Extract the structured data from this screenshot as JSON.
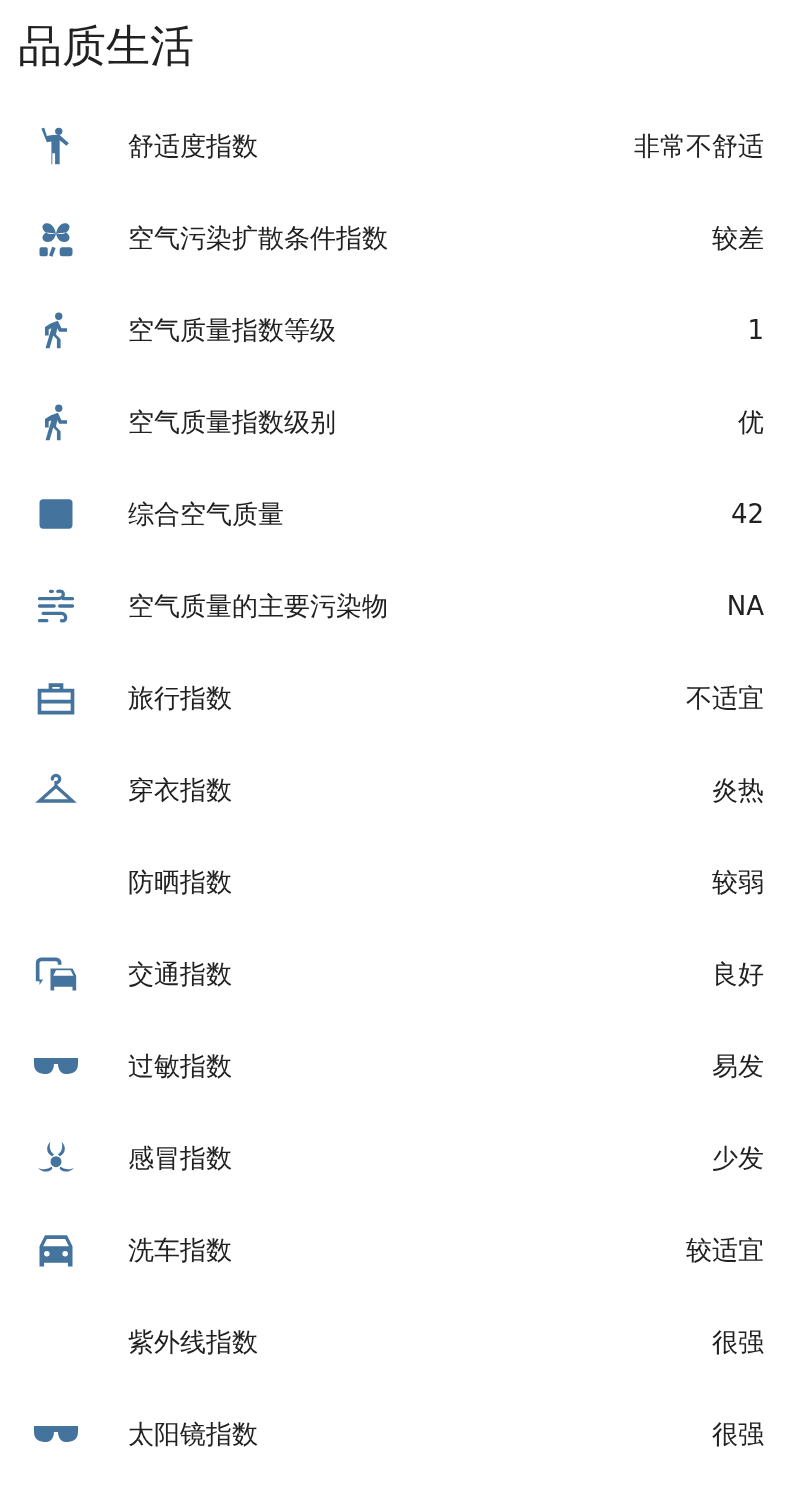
{
  "title": "品质生活",
  "rows": [
    {
      "label": "舒适度指数",
      "value": "非常不舒适"
    },
    {
      "label": "空气污染扩散条件指数",
      "value": "较差"
    },
    {
      "label": "空气质量指数等级",
      "value": "1"
    },
    {
      "label": "空气质量指数级别",
      "value": "优"
    },
    {
      "label": "综合空气质量",
      "value": "42"
    },
    {
      "label": "空气质量的主要污染物",
      "value": "NA"
    },
    {
      "label": "旅行指数",
      "value": "不适宜"
    },
    {
      "label": "穿衣指数",
      "value": "炎热"
    },
    {
      "label": "防晒指数",
      "value": "较弱"
    },
    {
      "label": "交通指数",
      "value": "良好"
    },
    {
      "label": "过敏指数",
      "value": "易发"
    },
    {
      "label": "感冒指数",
      "value": "少发"
    },
    {
      "label": "洗车指数",
      "value": "较适宜"
    },
    {
      "label": "紫外线指数",
      "value": "很强"
    },
    {
      "label": "太阳镜指数",
      "value": "很强"
    }
  ]
}
